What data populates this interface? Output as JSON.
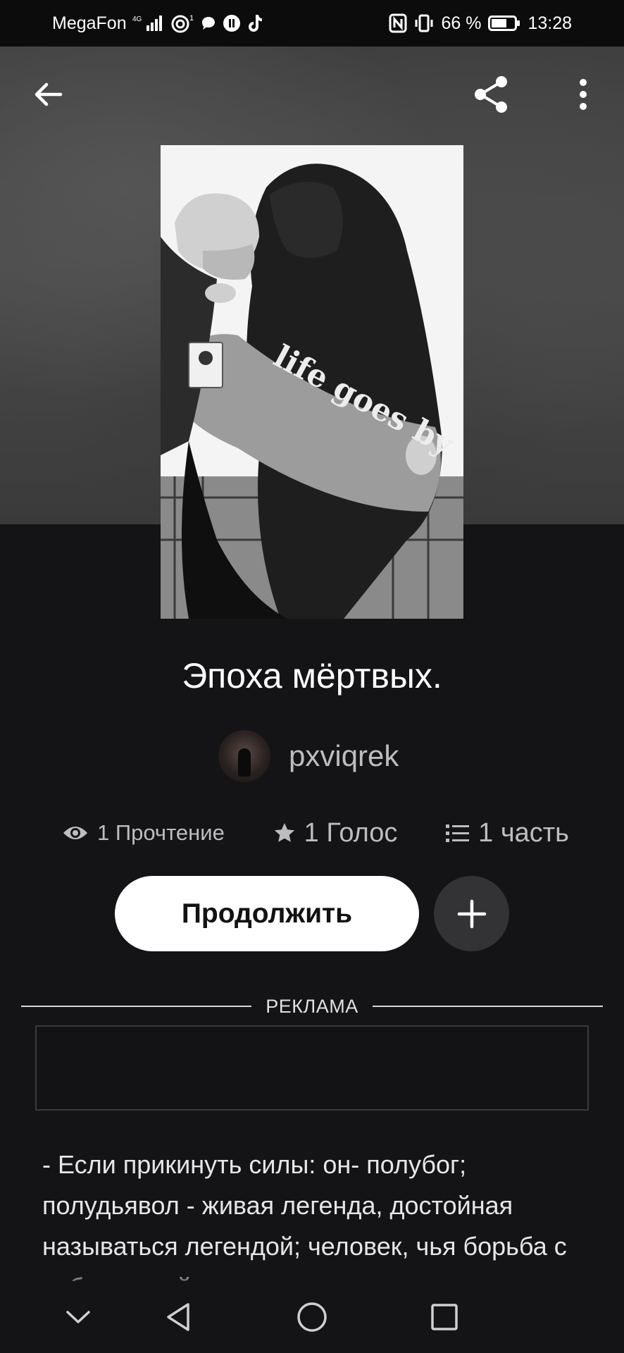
{
  "status_bar": {
    "carrier": "MegaFon",
    "network": "4G",
    "hotspot_count": "1",
    "battery": "66 %",
    "time": "13:28"
  },
  "top_bar": {
    "back_icon": "arrow-left-icon",
    "share_icon": "share-icon",
    "more_icon": "more-vertical-icon"
  },
  "book": {
    "cover_text": "life goes by",
    "title": "Эпоха мёртвых.",
    "author": "pxviqrek",
    "stats": {
      "reads": "1 Прочтение",
      "votes": "1 Голос",
      "parts": "1 часть"
    }
  },
  "actions": {
    "continue_label": "Продолжить",
    "add_icon": "plus-icon"
  },
  "ad": {
    "label": "РЕКЛАМА"
  },
  "story_preview": "- Если прикинуть силы: он- полубог; полудьявол - живая легенда, достойная называться легендой; человек, чья борьба с собственной яростью дух",
  "colors": {
    "background": "#141315",
    "button_primary": "#ffffff",
    "button_secondary": "#333234",
    "muted_text": "#bdbdbd"
  }
}
